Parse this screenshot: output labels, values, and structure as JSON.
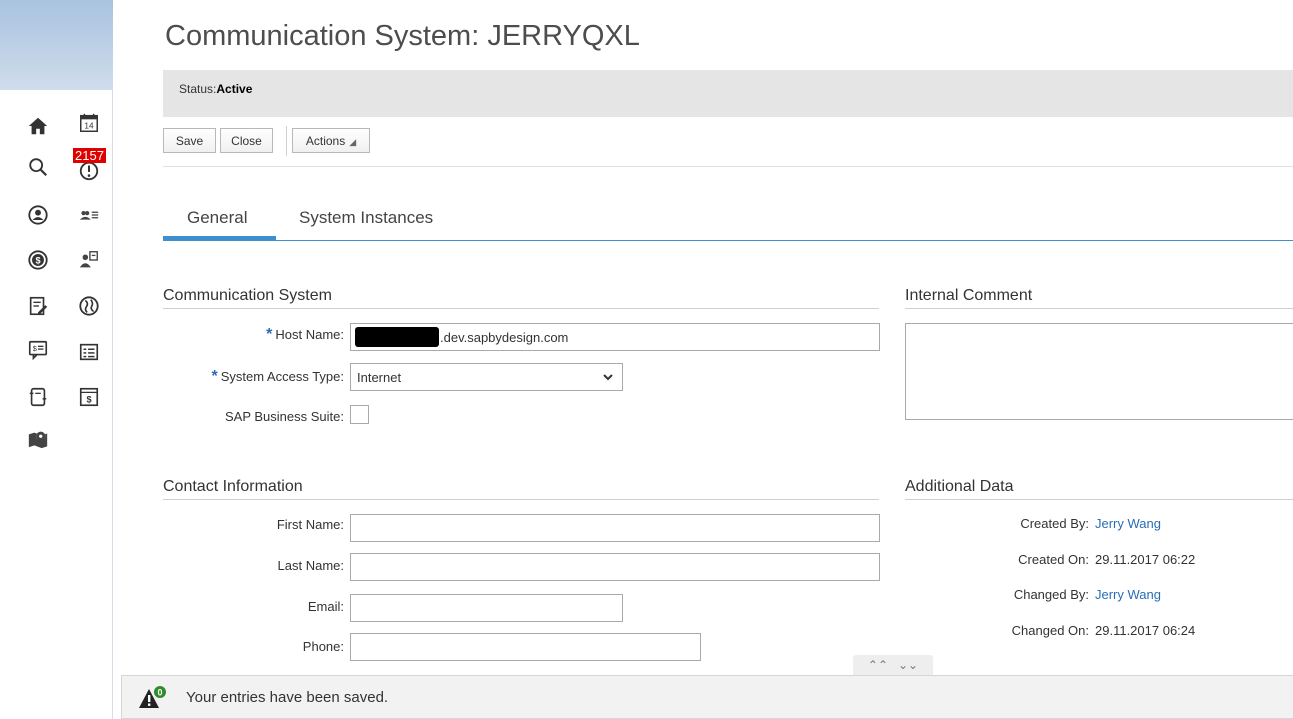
{
  "rail": {
    "badge": "2157",
    "icons": [
      "home-icon",
      "calendar-icon",
      "search-icon",
      "alert-icon",
      "account-icon",
      "people-list-icon",
      "dollar-icon",
      "employee-transfer-icon",
      "report-edit-icon",
      "globe-icon",
      "invoice-icon",
      "list-icon",
      "document-icon",
      "payment-icon",
      "map-pin-icon"
    ],
    "calendar_day": "14"
  },
  "page": {
    "title": "Communication System: JERRYQXL",
    "status_label": "Status:",
    "status_value": "Active"
  },
  "toolbar": {
    "save_label": "Save",
    "close_label": "Close",
    "actions_label": "Actions"
  },
  "tabs": {
    "general": "General",
    "system_instances": "System Instances",
    "active": "General"
  },
  "communication_system": {
    "title": "Communication System",
    "host_name_label": "Host Name:",
    "host_name_value": ".dev.sapbydesign.com",
    "access_type_label": "System Access Type:",
    "access_type_value": "Internet",
    "business_suite_label": "SAP Business Suite:",
    "business_suite_checked": false
  },
  "internal_comment": {
    "title": "Internal Comment",
    "value": ""
  },
  "contact": {
    "title": "Contact Information",
    "first_name_label": "First Name:",
    "last_name_label": "Last Name:",
    "email_label": "Email:",
    "phone_label": "Phone:",
    "first_name": "",
    "last_name": "",
    "email": "",
    "phone": ""
  },
  "additional_data": {
    "title": "Additional Data",
    "created_by_label": "Created By:",
    "created_by": "Jerry Wang",
    "created_on_label": "Created On:",
    "created_on": "29.11.2017 06:22",
    "changed_by_label": "Changed By:",
    "changed_by": "Jerry Wang",
    "changed_on_label": "Changed On:",
    "changed_on": "29.11.2017 06:24"
  },
  "message": {
    "count": "0",
    "text": "Your entries have been saved."
  },
  "colors": {
    "accent": "#3f8fce",
    "link": "#2a6db4",
    "badge": "#e00000"
  }
}
